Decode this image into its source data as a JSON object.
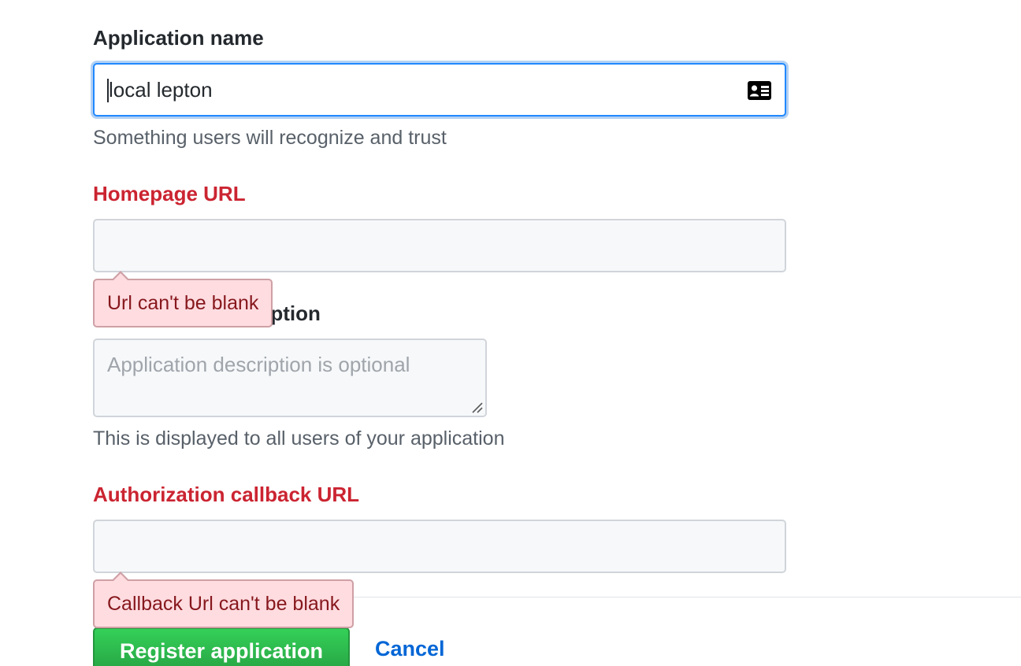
{
  "form": {
    "app_name": {
      "label": "Application name",
      "value": "local lepton",
      "note": "Something users will recognize and trust",
      "icon": "contact-card-icon"
    },
    "homepage_url": {
      "label": "Homepage URL",
      "value": "",
      "error": "Url can't be blank"
    },
    "description": {
      "label": "Application description",
      "placeholder": "Application description is optional",
      "note": "This is displayed to all users of your application"
    },
    "callback_url": {
      "label": "Authorization callback URL",
      "value": "",
      "error": "Callback Url can't be blank"
    }
  },
  "actions": {
    "register_label": "Register application",
    "cancel_label": "Cancel"
  },
  "colors": {
    "error_text": "#cb2431",
    "primary_button": "#28a745",
    "link": "#0366d6",
    "focus_border": "#2188ff"
  }
}
